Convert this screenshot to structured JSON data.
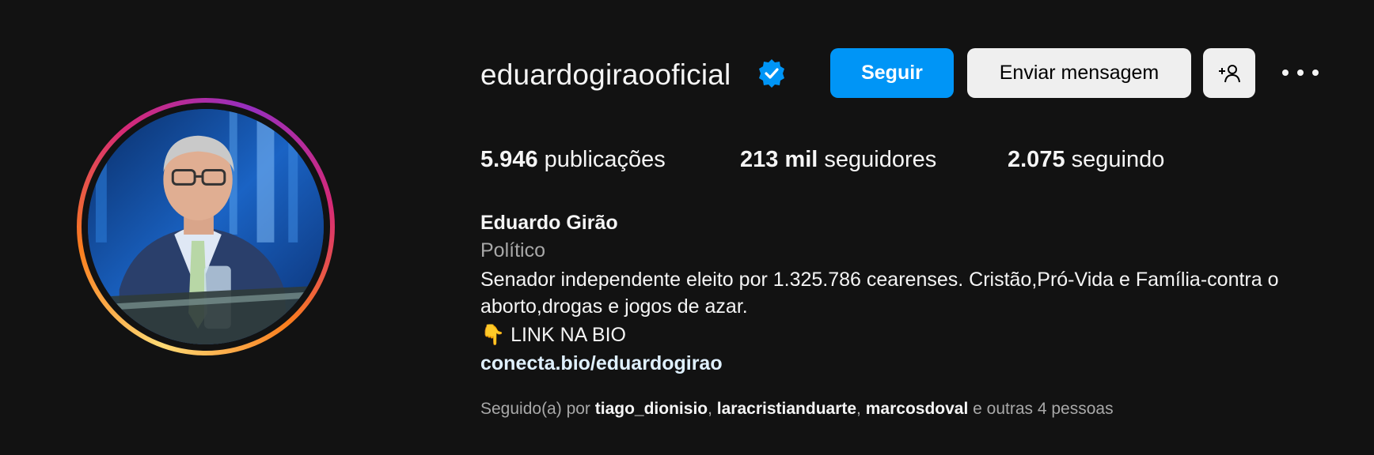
{
  "profile": {
    "username": "eduardogiraooficial",
    "verified_icon": "verified-badge-icon",
    "follow_label": "Seguir",
    "message_label": "Enviar mensagem",
    "suggest_icon": "add-person-icon",
    "more_icon": "more-options-icon"
  },
  "stats": {
    "posts_count": "5.946",
    "posts_label": "publicações",
    "followers_count": "213 mil",
    "followers_label": "seguidores",
    "following_count": "2.075",
    "following_label": "seguindo"
  },
  "bio": {
    "name": "Eduardo Girão",
    "category": "Político",
    "line1": "Senador independente eleito por 1.325.786 cearenses. Cristão,Pró-Vida e Família-contra o",
    "line2": "aborto,drogas e jogos de azar.",
    "line3": "👇 LINK NA BIO",
    "link": "conecta.bio/eduardogirao"
  },
  "followed_by": {
    "prefix": "Seguido(a) por",
    "user1": "tiago_dionisio",
    "sep1": ",",
    "user2": "laracristianduarte",
    "sep2": ",",
    "user3": "marcosdoval",
    "suffix": "e outras 4 pessoas"
  },
  "colors": {
    "background": "#121212",
    "follow_button": "#0095f6",
    "secondary_button": "#efefef",
    "verified": "#0095f6"
  }
}
